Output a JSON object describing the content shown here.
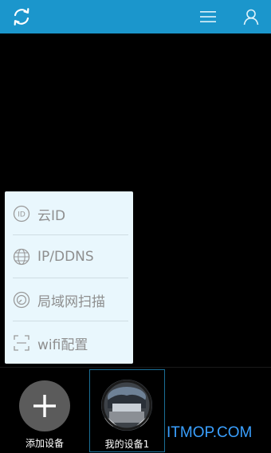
{
  "colors": {
    "topbar": "#1b96cc",
    "popup_bg": "#e9f7fd",
    "popup_text": "#8e8e8e",
    "add_circle": "#5b5b5b",
    "selected_border": "#1b6f96",
    "watermark": "#3aa0ff"
  },
  "topbar": {
    "left_icon": "refresh-icon",
    "right_icons": [
      "menu-icon",
      "user-icon"
    ]
  },
  "menu": {
    "items": [
      {
        "icon": "cloud-id-icon",
        "label": "云ID"
      },
      {
        "icon": "globe-icon",
        "label": "IP/DDNS"
      },
      {
        "icon": "lan-scan-icon",
        "label": "局域网扫描"
      },
      {
        "icon": "scan-frame-icon",
        "label": "wifi配置"
      }
    ]
  },
  "devices": {
    "add_label": "添加设备",
    "items": [
      {
        "name": "我的设备1"
      }
    ]
  },
  "watermark": "ITMOP.COM"
}
